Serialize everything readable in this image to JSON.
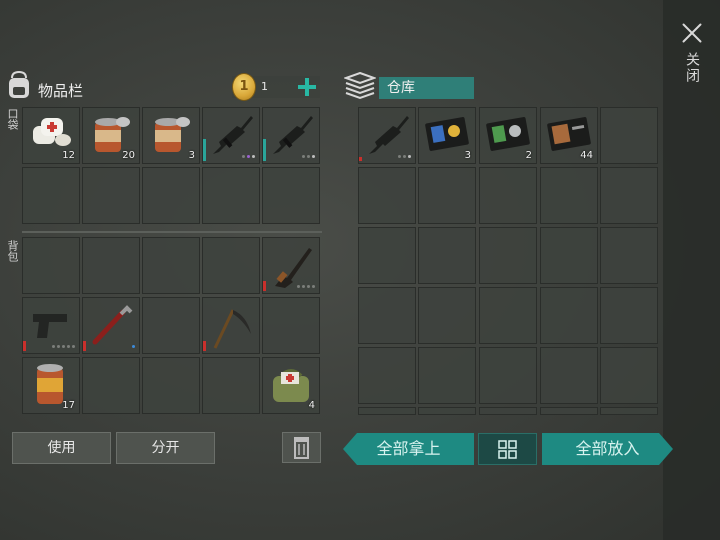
{
  "inventory": {
    "title": "物品栏",
    "coins": "1",
    "coin_symbol": "1",
    "pocket_label": "口袋",
    "backpack_label": "背包",
    "pocket_slots": [
      {
        "item": "bandage-icon",
        "qty": "12"
      },
      {
        "item": "canned-food-icon",
        "qty": "20"
      },
      {
        "item": "canned-food-icon",
        "qty": "3"
      },
      {
        "item": "assault-rifle-icon",
        "qty": ""
      },
      {
        "item": "assault-rifle-icon",
        "qty": ""
      }
    ],
    "backpack_slots": [
      {
        "item": "rifle-icon",
        "qty": ""
      },
      {
        "item": "pistol-icon",
        "qty": ""
      },
      {
        "item": "crowbar-icon",
        "qty": ""
      },
      {
        "item": "scythe-icon",
        "qty": ""
      },
      {
        "item": "canned-food-icon",
        "qty": "17"
      },
      {
        "item": "medkit-bag-icon",
        "qty": "4"
      }
    ]
  },
  "storage": {
    "title": "仓库",
    "slots": [
      {
        "item": "assault-rifle-icon",
        "qty": ""
      },
      {
        "item": "police-badge-icon",
        "qty": "3"
      },
      {
        "item": "id-badge-green-icon",
        "qty": "2"
      },
      {
        "item": "id-card-brown-icon",
        "qty": "44"
      }
    ]
  },
  "buttons": {
    "use": "使用",
    "split": "分开",
    "take_all": "全部拿上",
    "put_all": "全部放入"
  },
  "close_label": "关闭",
  "colors": {
    "accent": "#1e8a82",
    "durability_low": "#c9302c",
    "durability_full": "#2aa59a"
  }
}
